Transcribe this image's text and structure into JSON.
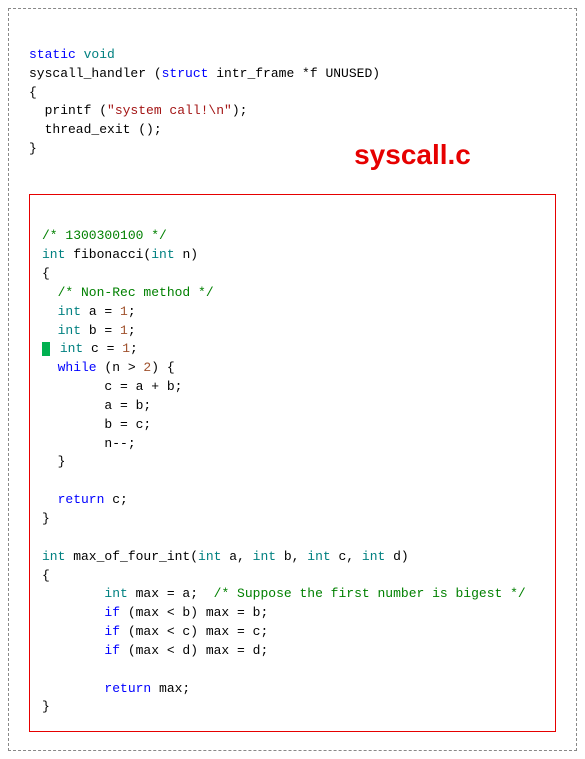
{
  "filelabel": "syscall.c",
  "top": {
    "l1a": "static",
    "l1b": "void",
    "l2a": "syscall_handler (",
    "l2b": "struct",
    "l2c": " intr_frame *f UNUSED)",
    "l3": "{",
    "l4a": "  printf (",
    "l4b": "\"system call!\\n\"",
    "l4c": ");",
    "l5": "  thread_exit ();",
    "l6": "}"
  },
  "bot": {
    "c0": "/* 1300300100 */",
    "f1a": "int",
    "f1b": " fibonacci(",
    "f1c": "int",
    "f1d": " n)",
    "ob": "{",
    "c1": "  /* Non-Rec method */",
    "va": "  int",
    "vaN": " a = ",
    "va1": "1",
    "vaE": ";",
    "vb": "  int",
    "vbN": " b = ",
    "vb1": "1",
    "vbE": ";",
    "vcPre": " ",
    "vc": "int",
    "vcN": " c = ",
    "vc1": "1",
    "vcE": ";",
    "wh": "  while",
    "whC": " (n > ",
    "wh2": "2",
    "whE": ") {",
    "l_c": "        c = a + b;",
    "l_a": "        a = b;",
    "l_b": "        b = c;",
    "l_n": "        n--;",
    "cb1": "  }",
    "blank": "",
    "ret1a": "  return",
    "ret1b": " c;",
    "cb2": "}",
    "m1a": "int",
    "m1b": " max_of_four_int(",
    "m1c": "int",
    "m1d": " a, ",
    "m1e": "int",
    "m1f": " b, ",
    "m1g": "int",
    "m1h": " c, ",
    "m1i": "int",
    "m1j": " d)",
    "ob2": "{",
    "mxA": "        int",
    "mxB": " max = a;  ",
    "mxC": "/* Suppose the first number is bigest */",
    "ifb": "        if",
    "ifbC": " (max < b) max = b;",
    "ifc": "        if",
    "ifcC": " (max < c) max = c;",
    "ifd": "        if",
    "ifdC": " (max < d) max = d;",
    "ret2a": "        return",
    "ret2b": " max;",
    "cb3": "}"
  }
}
